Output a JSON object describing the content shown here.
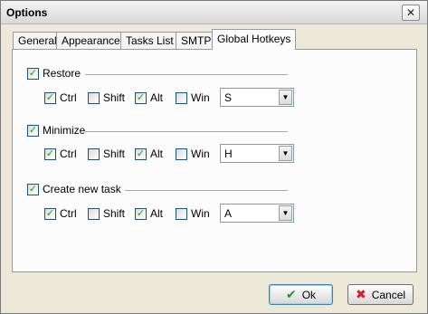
{
  "window": {
    "title": "Options",
    "close_glyph": "✕"
  },
  "tabs": [
    {
      "label": "General"
    },
    {
      "label": "Appearance"
    },
    {
      "label": "Tasks List"
    },
    {
      "label": "SMTP"
    },
    {
      "label": "Global Hotkeys",
      "active": true
    }
  ],
  "hotkeys": [
    {
      "label": "Restore",
      "enabled": true,
      "ctrl": true,
      "shift": false,
      "alt": true,
      "win": false,
      "key": "S"
    },
    {
      "label": "Minimize",
      "enabled": true,
      "ctrl": true,
      "shift": false,
      "alt": true,
      "win": false,
      "key": "H"
    },
    {
      "label": "Create new task",
      "enabled": true,
      "ctrl": true,
      "shift": false,
      "alt": true,
      "win": false,
      "key": "A"
    }
  ],
  "modifier_labels": {
    "ctrl": "Ctrl",
    "shift": "Shift",
    "alt": "Alt",
    "win": "Win"
  },
  "glyphs": {
    "check": "✓",
    "dropdown": "▼"
  },
  "buttons": {
    "ok": {
      "label": "Ok",
      "icon": "✔",
      "icon_color": "#1f9a1f"
    },
    "cancel": {
      "label": "Cancel",
      "icon": "✖",
      "icon_color": "#d02020"
    }
  }
}
